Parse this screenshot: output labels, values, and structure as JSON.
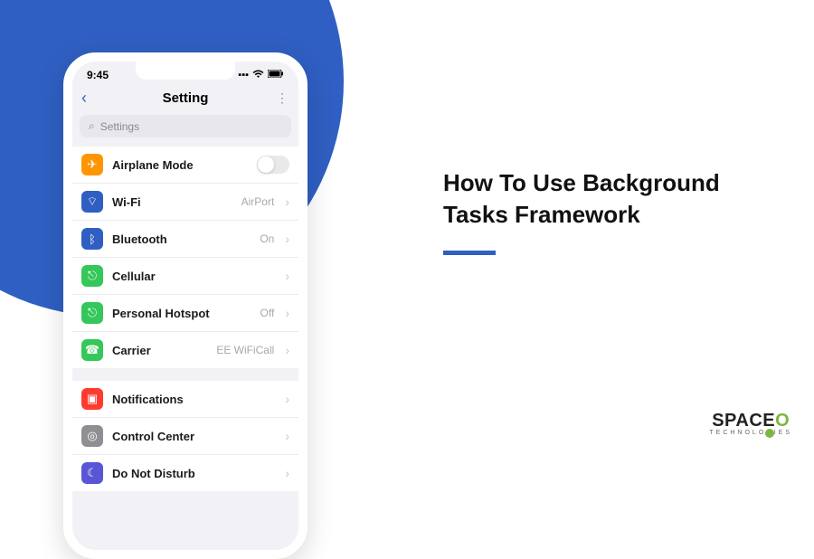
{
  "headline": {
    "line1": "How To Use Background",
    "line2": "Tasks Framework"
  },
  "brand": {
    "name_pre": "SPACE",
    "name_o": "O",
    "sub": "TECHNOLOGIES"
  },
  "phone": {
    "status": {
      "time": "9:45",
      "signal": "▪▪▪",
      "wifi": "⌘",
      "battery": "▮"
    },
    "nav": {
      "title": "Setting",
      "back": "‹",
      "more": "⋮"
    },
    "search": {
      "placeholder": "Settings",
      "icon": "⌕"
    },
    "group1": [
      {
        "icon_bg": "#ff9500",
        "icon": "✈",
        "label": "Airplane Mode",
        "control": "toggle"
      },
      {
        "icon_bg": "#2f5fc2",
        "icon": "⌔",
        "label": "Wi-Fi",
        "value": "AirPort",
        "control": "chevron"
      },
      {
        "icon_bg": "#2f5fc2",
        "icon": "ᛒ",
        "label": "Bluetooth",
        "value": "On",
        "control": "chevron"
      },
      {
        "icon_bg": "#34c759",
        "icon": "⎋",
        "label": "Cellular",
        "value": "",
        "control": "chevron"
      },
      {
        "icon_bg": "#34c759",
        "icon": "⎋",
        "label": "Personal Hotspot",
        "value": "Off",
        "control": "chevron"
      },
      {
        "icon_bg": "#34c759",
        "icon": "☎",
        "label": "Carrier",
        "value": "EE WiFiCall",
        "control": "chevron"
      }
    ],
    "group2": [
      {
        "icon_bg": "#ff3b30",
        "icon": "▣",
        "label": "Notifications",
        "value": "",
        "control": "chevron"
      },
      {
        "icon_bg": "#8e8e93",
        "icon": "◎",
        "label": "Control Center",
        "value": "",
        "control": "chevron"
      },
      {
        "icon_bg": "#5856d6",
        "icon": "☾",
        "label": "Do Not Disturb",
        "value": "",
        "control": "chevron"
      }
    ]
  }
}
